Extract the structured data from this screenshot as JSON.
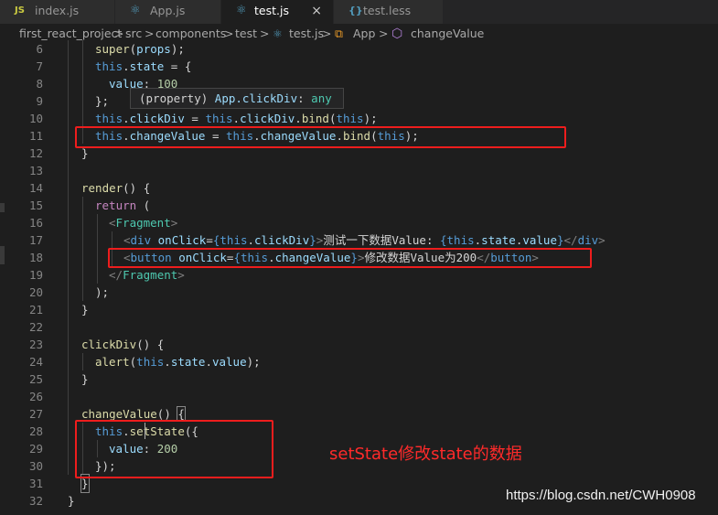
{
  "tabs": [
    {
      "icon": "JS",
      "label": "index.js"
    },
    {
      "icon": "⚛",
      "label": "App.js"
    },
    {
      "icon": "⚛",
      "label": "test.js",
      "close": "×"
    },
    {
      "icon": "{}",
      "label": "test.less"
    }
  ],
  "breadcrumb": {
    "items": [
      "first_react_project",
      "src",
      "components",
      "test",
      "test.js",
      "App",
      "changeValue"
    ],
    "sep": ">"
  },
  "hover": {
    "prop": "(property)",
    "name": "App.clickDiv",
    "type": "any"
  },
  "lines": [
    {
      "n": "6"
    },
    {
      "n": "7"
    },
    {
      "n": "8"
    },
    {
      "n": "9"
    },
    {
      "n": "10"
    },
    {
      "n": "11"
    },
    {
      "n": "12"
    },
    {
      "n": "13"
    },
    {
      "n": "14"
    },
    {
      "n": "15"
    },
    {
      "n": "16"
    },
    {
      "n": "17"
    },
    {
      "n": "18"
    },
    {
      "n": "19"
    },
    {
      "n": "20"
    },
    {
      "n": "21"
    },
    {
      "n": "22"
    },
    {
      "n": "23"
    },
    {
      "n": "24"
    },
    {
      "n": "25"
    },
    {
      "n": "26"
    },
    {
      "n": "27"
    },
    {
      "n": "28"
    },
    {
      "n": "29"
    },
    {
      "n": "30"
    },
    {
      "n": "31"
    },
    {
      "n": "32"
    }
  ],
  "code": {
    "l6": [
      "super",
      "(",
      "props",
      ");"
    ],
    "l7": [
      "this",
      ".",
      "state",
      " = {"
    ],
    "l8": [
      "value",
      ": ",
      "100"
    ],
    "l9": [
      "};"
    ],
    "l10": [
      "this",
      ".",
      "clickDiv",
      " = ",
      "this",
      ".",
      "clickDiv",
      ".",
      "bind",
      "(",
      "this",
      ");"
    ],
    "l11": [
      "this",
      ".",
      "changeValue",
      " = ",
      "this",
      ".",
      "changeValue",
      ".",
      "bind",
      "(",
      "this",
      ");"
    ],
    "l12": [
      "}"
    ],
    "l14": [
      "render",
      "() {"
    ],
    "l15": [
      "return",
      " ("
    ],
    "l16": [
      "<",
      "Fragment",
      ">"
    ],
    "l17": [
      "<",
      "div",
      " ",
      "onClick",
      "=",
      "{",
      "this",
      ".",
      "clickDiv",
      "}",
      ">",
      "测试一下数据Value: ",
      "{",
      "this",
      ".",
      "state",
      ".",
      "value",
      "}",
      "</",
      "div",
      ">"
    ],
    "l18": [
      "<",
      "button",
      " ",
      "onClick",
      "=",
      "{",
      "this",
      ".",
      "changeValue",
      "}",
      ">",
      "修改数据Value为200",
      "</",
      "button",
      ">"
    ],
    "l19": [
      "</",
      "Fragment",
      ">"
    ],
    "l20": [
      ");"
    ],
    "l21": [
      "}"
    ],
    "l23": [
      "clickDiv",
      "() {"
    ],
    "l24": [
      "alert",
      "(",
      "this",
      ".",
      "state",
      ".",
      "value",
      ");"
    ],
    "l25": [
      "}"
    ],
    "l27": [
      "changeValue",
      "() ",
      "{"
    ],
    "l28": [
      "this",
      ".",
      "se",
      "tState",
      "({"
    ],
    "l29": [
      "value",
      ": ",
      "200"
    ],
    "l30": [
      "});"
    ],
    "l31": [
      "}"
    ],
    "l32": [
      "}"
    ]
  },
  "annotation": "setState修改state的数据",
  "watermark": "https://blog.csdn.net/CWH0908",
  "colors": {
    "annotation": "#ff2a2a",
    "redbox": "#ee1d1d",
    "background": "#1e1e1e"
  }
}
